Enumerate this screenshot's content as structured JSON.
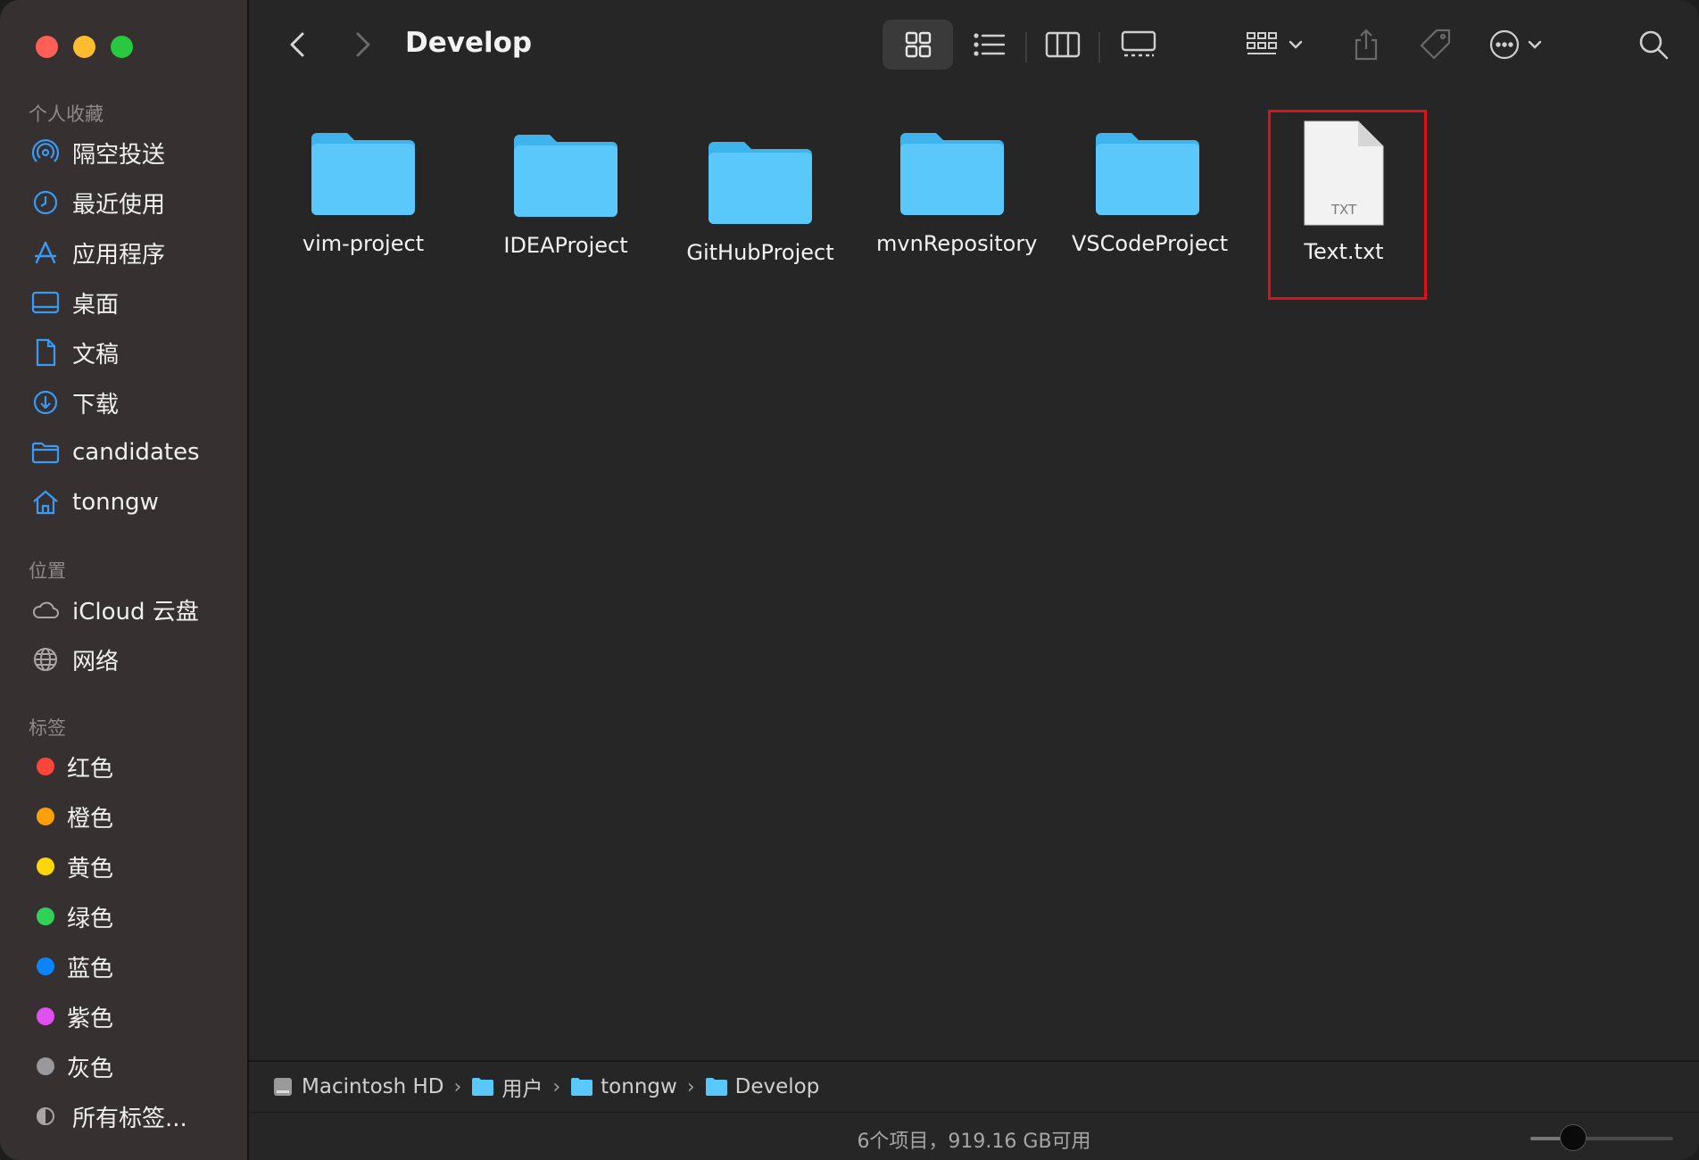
{
  "window": {
    "title": "Develop"
  },
  "sidebar": {
    "favorites_title": "个人收藏",
    "favorites": [
      {
        "label": "隔空投送",
        "icon": "airdrop-icon"
      },
      {
        "label": "最近使用",
        "icon": "clock-icon"
      },
      {
        "label": "应用程序",
        "icon": "applications-icon"
      },
      {
        "label": "桌面",
        "icon": "desktop-icon"
      },
      {
        "label": "文稿",
        "icon": "document-icon"
      },
      {
        "label": "下载",
        "icon": "download-icon"
      },
      {
        "label": "candidates",
        "icon": "folder-icon"
      },
      {
        "label": "tonngw",
        "icon": "home-icon"
      }
    ],
    "locations_title": "位置",
    "locations": [
      {
        "label": "iCloud 云盘",
        "icon": "cloud-icon"
      },
      {
        "label": "网络",
        "icon": "network-icon"
      }
    ],
    "tags_title": "标签",
    "tags": [
      {
        "label": "红色",
        "color": "#ff453a"
      },
      {
        "label": "橙色",
        "color": "#ff9f0a"
      },
      {
        "label": "黄色",
        "color": "#ffd60a"
      },
      {
        "label": "绿色",
        "color": "#30d158"
      },
      {
        "label": "蓝色",
        "color": "#0a84ff"
      },
      {
        "label": "紫色",
        "color": "#e04ff0"
      },
      {
        "label": "灰色",
        "color": "#98989d"
      }
    ],
    "all_tags": "所有标签..."
  },
  "files": [
    {
      "name": "vim-project",
      "type": "folder"
    },
    {
      "name": "IDEAProject",
      "type": "folder"
    },
    {
      "name": "GitHubProject",
      "type": "folder"
    },
    {
      "name": "mvnRepository",
      "type": "folder"
    },
    {
      "name": "VSCodeProject",
      "type": "folder"
    },
    {
      "name": "Text.txt",
      "type": "txt",
      "badge": "TXT",
      "highlighted": true
    }
  ],
  "pathbar": [
    "Macintosh HD",
    "用户",
    "tonngw",
    "Develop"
  ],
  "status": {
    "text": "6个项目，919.16 GB可用",
    "zoom_level": 0.3
  },
  "colors": {
    "folder": "#5ac8fa",
    "highlight": "#e0101a",
    "accent": "#0a84ff"
  }
}
